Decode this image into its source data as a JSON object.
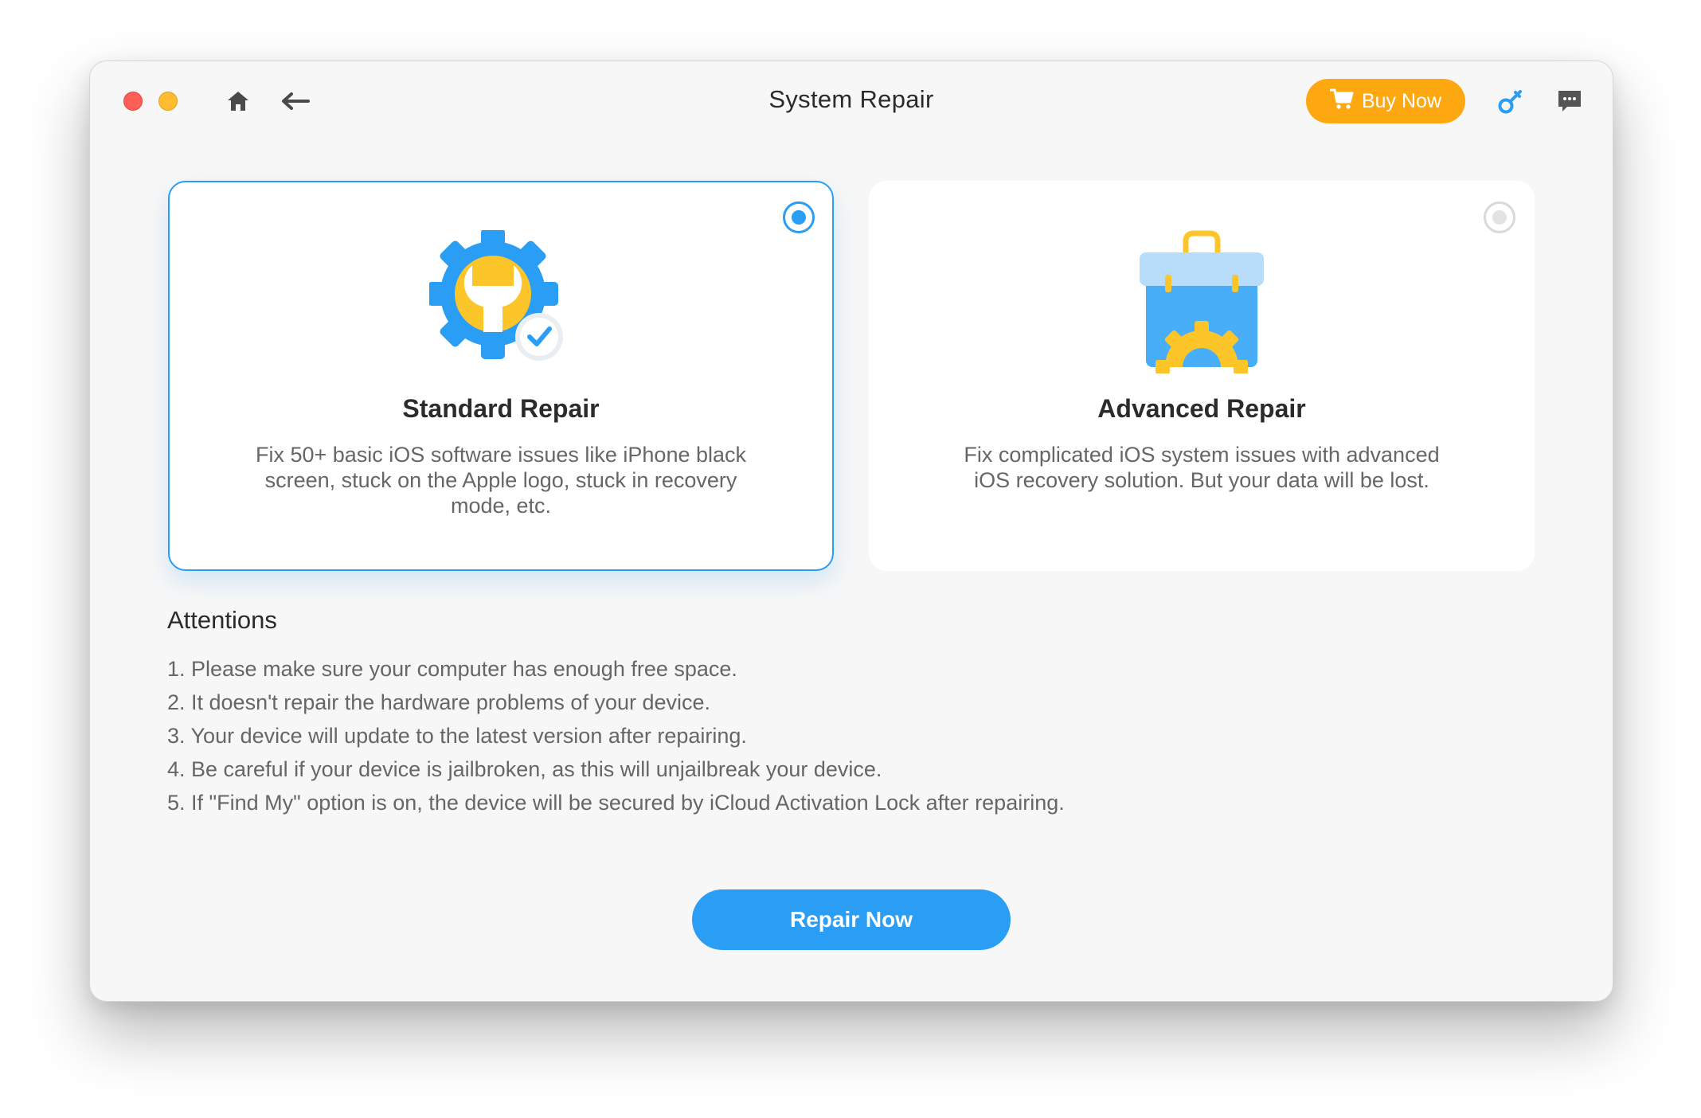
{
  "window": {
    "title": "System Repair"
  },
  "toolbar": {
    "buy_label": "Buy Now",
    "icons": [
      "home-icon",
      "back-arrow-icon",
      "cart-icon",
      "key-icon",
      "feedback-icon"
    ]
  },
  "options": [
    {
      "title": "Standard Repair",
      "description": "Fix 50+ basic iOS software issues like iPhone black screen, stuck on the Apple logo, stuck in recovery mode, etc.",
      "selected": true,
      "icon": "gear-wrench-check-icon"
    },
    {
      "title": "Advanced Repair",
      "description": "Fix complicated iOS system issues with advanced iOS recovery solution. But your data will be lost.",
      "selected": false,
      "icon": "toolbox-icon"
    }
  ],
  "attentions": {
    "title": "Attentions",
    "items": [
      "1. Please make sure your computer has enough free space.",
      "2. It doesn't repair the hardware problems of your device.",
      "3. Your device will update to the latest version after repairing.",
      "4. Be careful if your device is jailbroken, as this will unjailbreak your device.",
      "5. If \"Find My\" option is on, the device will be secured by iCloud Activation Lock after repairing."
    ]
  },
  "action": {
    "repair_label": "Repair Now"
  },
  "colors": {
    "accent": "#2a9df4",
    "buy": "#fea811",
    "gear_yellow": "#fcc62b"
  }
}
